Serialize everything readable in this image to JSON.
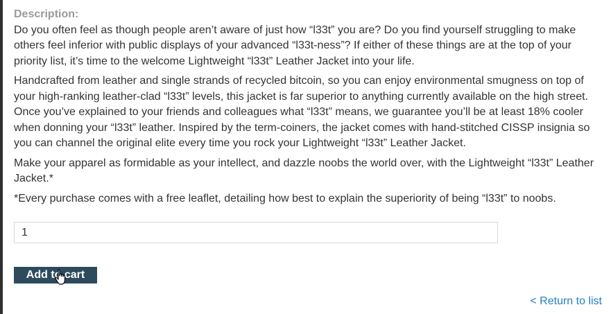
{
  "description": {
    "label": "Description:",
    "paragraphs": [
      "Do you often feel as though people aren’t aware of just how “l33t” you are? Do you find yourself struggling to make others feel inferior with public displays of your advanced “l33t-ness”? If either of these things are at the top of your priority list, it’s time to the welcome Lightweight “l33t” Leather Jacket into your life.",
      "Handcrafted from leather and single strands of recycled bitcoin, so you can enjoy environmental smugness on top of your high-ranking leather-clad “l33t” levels, this jacket is far superior to anything currently available on the high street. Once you’ve explained to your friends and colleagues what “l33t” means, we guarantee you’ll be at least 18% cooler when donning your “l33t” leather. Inspired by the term-coiners, the jacket comes with hand-stitched CISSP insignia so you can channel the original elite every time you rock your Lightweight “l33t” Leather Jacket.",
      "Make your apparel as formidable as your intellect, and dazzle noobs the world over, with the Lightweight “l33t” Leather Jacket.*",
      "*Every purchase comes with a free leaflet, detailing how best to explain the superiority of being “l33t” to noobs."
    ]
  },
  "quantity": {
    "value": "1"
  },
  "add_to_cart": {
    "label": "Add to cart"
  },
  "return_link": {
    "label": "< Return to list"
  },
  "icons": {
    "cursor": "hand-pointer-cursor-icon"
  },
  "colors": {
    "button_bg": "#2e4b5e",
    "link": "#1f7fc0",
    "label": "#9a9a9a",
    "text": "#333333"
  }
}
